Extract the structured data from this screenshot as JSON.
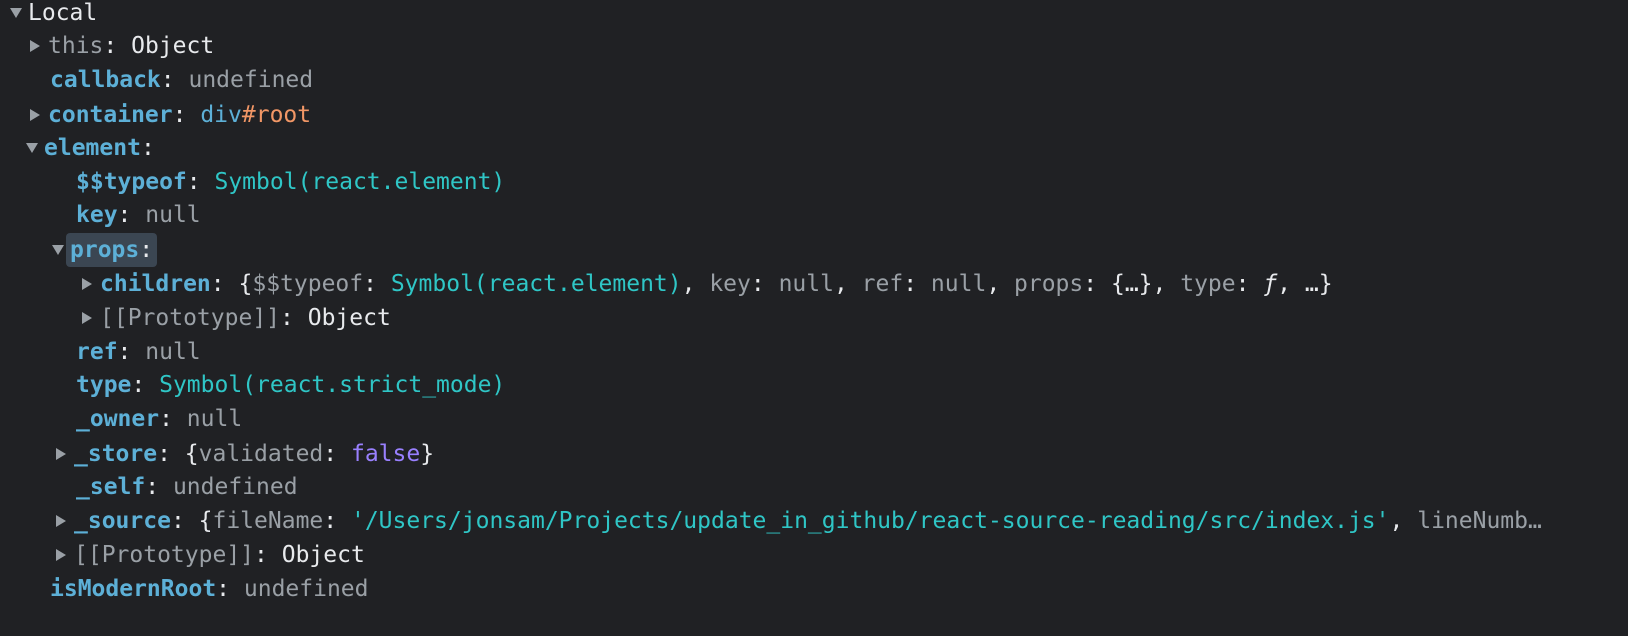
{
  "scope": {
    "title": "Local"
  },
  "rows": {
    "this": {
      "key": "this",
      "value": "Object"
    },
    "callback": {
      "key": "callback",
      "value": "undefined"
    },
    "container": {
      "key": "container",
      "tag": "div",
      "id": "#root"
    },
    "element": {
      "key": "element"
    },
    "typeof": {
      "key": "$$typeof",
      "value": "Symbol(react.element)"
    },
    "key": {
      "key": "key",
      "value": "null"
    },
    "props": {
      "key": "props"
    },
    "children": {
      "key": "children",
      "preview": {
        "open": "{",
        "k1": "$$typeof",
        "v1": "Symbol(react.element)",
        "k2": "key",
        "v2": "null",
        "k3": "ref",
        "v3": "null",
        "k4": "props",
        "v4": "{…}",
        "k5": "type",
        "v5": "ƒ",
        "tail": "…}"
      }
    },
    "props_proto": {
      "key": "[[Prototype]]",
      "value": "Object"
    },
    "ref": {
      "key": "ref",
      "value": "null"
    },
    "type": {
      "key": "type",
      "value": "Symbol(react.strict_mode)"
    },
    "owner": {
      "key": "_owner",
      "value": "null"
    },
    "store": {
      "key": "_store",
      "preview_key": "validated",
      "preview_value": "false"
    },
    "self": {
      "key": "_self",
      "value": "undefined"
    },
    "source": {
      "key": "_source",
      "preview_key": "fileName",
      "preview_value": "'/Users/jonsam/Projects/update_in_github/react-source-reading/src/index.js'",
      "next_key": "lineNumb…"
    },
    "element_proto": {
      "key": "[[Prototype]]",
      "value": "Object"
    },
    "isModernRoot": {
      "key": "isModernRoot",
      "value": "undefined"
    }
  },
  "colors": {
    "background": "#202124",
    "own_key": "#5db0d7",
    "symbol": "#2fc6c6",
    "id": "#f29766",
    "boolean": "#9980ff",
    "muted": "#9aa0a6"
  }
}
